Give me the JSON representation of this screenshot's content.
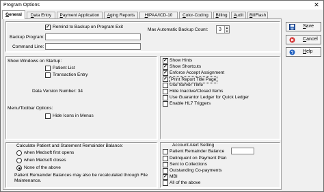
{
  "window": {
    "title": "Program Options",
    "close_glyph": "✕"
  },
  "tabs": [
    {
      "label": "General",
      "underline": "G",
      "rest": "eneral",
      "active": true
    },
    {
      "label": "Data Entry",
      "underline": "D",
      "rest": "ata Entry"
    },
    {
      "label": "Payment Application",
      "underline": "P",
      "rest": "ayment Application"
    },
    {
      "label": "Aging Reports",
      "underline": "A",
      "rest": "ging Reports"
    },
    {
      "label": "HIPAA/ICD-10",
      "underline": "H",
      "rest": "IPAA/ICD-10"
    },
    {
      "label": "Color-Coding",
      "underline": "C",
      "rest": "olor-Coding"
    },
    {
      "label": "Billing",
      "underline": "B",
      "rest": "illing"
    },
    {
      "label": "Audit",
      "underline": "A",
      "rest": "udit"
    },
    {
      "label": "BillFlash",
      "underline": "B",
      "rest": "illFlash"
    }
  ],
  "backup": {
    "remind_label": "Remind to Backup on Program Exit",
    "remind_checked": true,
    "program_label": "Backup Program:",
    "program_value": "",
    "command_label": "Command Line:",
    "command_value": "",
    "max_label": "Max Automatic Backup Count:",
    "max_value": "3"
  },
  "startup": {
    "title": "Show Windows on Startup:",
    "patient_list": "Patient List",
    "transaction_entry": "Transaction Entry",
    "data_version": "Data Version Number: 34",
    "menu_title": "Menu/Toolbar Options:",
    "hide_icons": "Hide Icons in Menus"
  },
  "display_options": [
    {
      "label": "Show Hints",
      "checked": true
    },
    {
      "label": "Show Shortcuts",
      "checked": true
    },
    {
      "label": "Enforce Accept Assignment",
      "checked": true
    },
    {
      "label": "Print Report Title Page",
      "checked": true
    },
    {
      "label": "Use Server Time",
      "checked": false
    },
    {
      "label": "Hide Inactive/Closed Items",
      "checked": false
    },
    {
      "label": "Use Guarantor Ledger for Quick Ledger",
      "checked": false
    },
    {
      "label": "Enable HL7 Triggers",
      "checked": false
    }
  ],
  "remainder": {
    "title": "Calculate Patient and Statement Remainder Balance:",
    "options": [
      {
        "label": "when Medsoft first opens",
        "selected": false
      },
      {
        "label": "when Medsoft closes",
        "selected": false
      },
      {
        "label": "None of the above",
        "selected": true
      }
    ],
    "note": "Patient Remainder Balances may also be recalculated through File Maintenance."
  },
  "alert": {
    "title": "Account Alert Setting",
    "options": [
      {
        "label": "Patient Remainder Balance",
        "checked": false
      },
      {
        "label": "Delinquent on Payment Plan",
        "checked": false
      },
      {
        "label": "Sent to Collections",
        "checked": false
      },
      {
        "label": "Outstanding Co-payments",
        "checked": false
      },
      {
        "label": "MBI",
        "checked": true
      },
      {
        "label": "All of the above",
        "checked": false
      }
    ],
    "threshold_value": ""
  },
  "buttons": {
    "save": {
      "label": "Save",
      "icon": "save-icon",
      "underline": "S",
      "rest": "ave"
    },
    "cancel": {
      "label": "Cancel",
      "icon": "cancel-icon",
      "underline": "C",
      "rest": "ancel"
    },
    "help": {
      "label": "Help",
      "icon": "help-icon",
      "underline": "H",
      "rest": "elp"
    }
  },
  "colors": {
    "save_icon": "#2a5db0",
    "cancel_icon": "#d02020",
    "help_icon": "#2060c0"
  }
}
